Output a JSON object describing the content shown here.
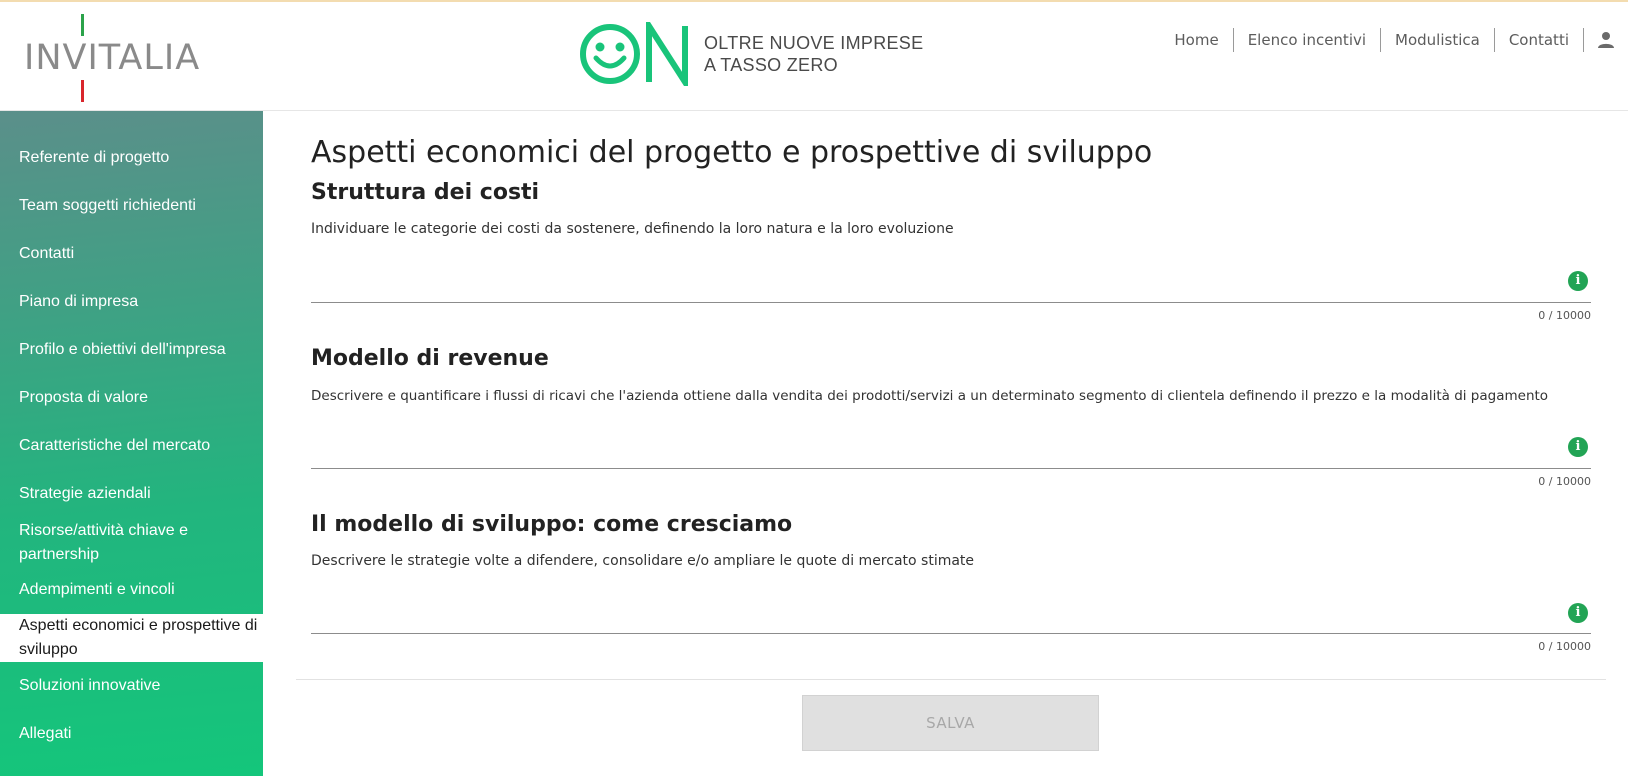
{
  "header": {
    "brand": "INVITALIA",
    "logo_mark": "ON",
    "tagline_line1": "OLTRE NUOVE IMPRESE",
    "tagline_line2": "A TASSO ZERO",
    "nav": [
      "Home",
      "Elenco incentivi",
      "Modulistica",
      "Contatti"
    ],
    "user_icon": "user-icon",
    "colors": {
      "brand_green": "#19c47a",
      "flag_green": "#2ba34a",
      "flag_red": "#d9262c"
    }
  },
  "sidebar": {
    "items": [
      {
        "label": "Referente di progetto"
      },
      {
        "label": "Team soggetti richiedenti"
      },
      {
        "label": "Contatti"
      },
      {
        "label": "Piano di impresa"
      },
      {
        "label": "Profilo e obiettivi dell'impresa"
      },
      {
        "label": "Proposta di valore"
      },
      {
        "label": "Caratteristiche del mercato"
      },
      {
        "label": "Strategie aziendali"
      },
      {
        "label": "Risorse/attività chiave e partnership"
      },
      {
        "label": "Adempimenti e vincoli"
      },
      {
        "label": "Aspetti economici e prospettive di sviluppo"
      },
      {
        "label": "Soluzioni innovative"
      },
      {
        "label": "Allegati"
      }
    ],
    "active_index": 10
  },
  "main": {
    "title": "Aspetti economici del progetto e prospettive di sviluppo",
    "sections": [
      {
        "title": "Struttura dei costi",
        "description": "Individuare le categorie dei costi da sostenere, definendo la loro natura e la loro evoluzione",
        "value": "",
        "counter": "0 / 10000"
      },
      {
        "title": "Modello di revenue",
        "description": "Descrivere e quantificare i flussi di ricavi che l'azienda ottiene dalla vendita dei prodotti/servizi a un determinato segmento di clientela definendo il prezzo e la modalità di pagamento",
        "value": "",
        "counter": "0 / 10000"
      },
      {
        "title": "Il modello di sviluppo: come cresciamo",
        "description": "Descrivere le strategie volte a difendere, consolidare e/o ampliare le quote di mercato stimate",
        "value": "",
        "counter": "0 / 10000"
      }
    ],
    "save_label": "SALVA"
  }
}
